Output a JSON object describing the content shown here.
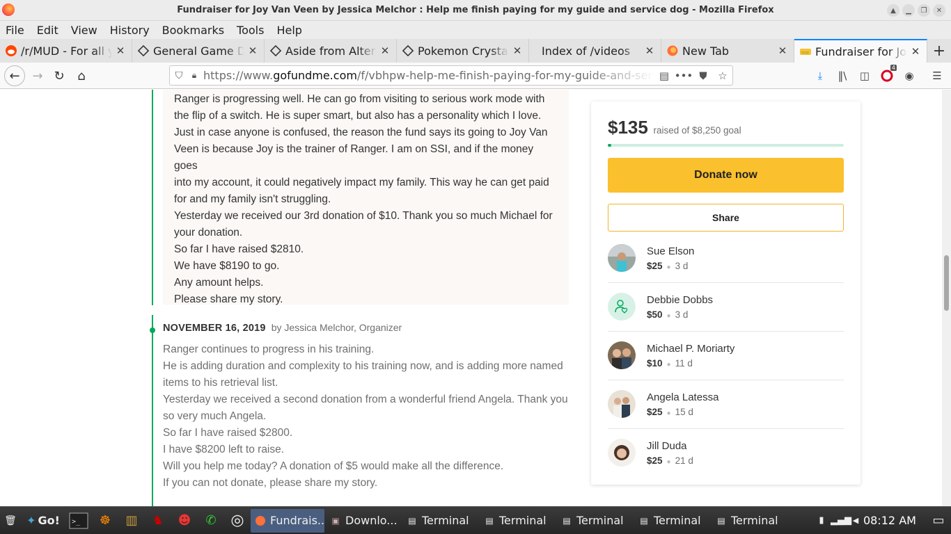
{
  "window": {
    "title": "Fundraiser for Joy Van Veen by Jessica Melchor : Help me finish paying for my guide and service dog - Mozilla Firefox"
  },
  "menu": [
    "File",
    "Edit",
    "View",
    "History",
    "Bookmarks",
    "Tools",
    "Help"
  ],
  "tabs": [
    {
      "label": "/r/MUD - For all your MUD needs",
      "icon": "reddit-icon"
    },
    {
      "label": "General Game Discussion",
      "icon": "diamond-icon"
    },
    {
      "label": "Aside from Alter aeon",
      "icon": "diamond-icon"
    },
    {
      "label": "Pokemon Crystal audio game",
      "icon": "diamond-icon"
    },
    {
      "label": "Index of /videos",
      "icon": ""
    },
    {
      "label": "New Tab",
      "icon": "firefox-icon"
    },
    {
      "label": "Fundraiser for Joy Van Veen",
      "icon": "gofundme-icon"
    }
  ],
  "urlbar": {
    "prefix": "https://www.",
    "domain": "gofundme.com",
    "path": "/f/vbhpw-help-me-finish-paying-for-my-guide-and-service-dog"
  },
  "toolbar": {
    "notification_count": "4"
  },
  "update1": {
    "lines": [
      "Ranger is progressing well. He can go from visiting to serious work mode with",
      "the flip of a switch. He is super smart, but also has a personality which I love.",
      "Just in case anyone is confused, the reason the fund says its going to Joy Van",
      "Veen is because Joy is the trainer of Ranger. I am on SSI, and if the money goes",
      "into my account, it could negatively impact my family. This way he can get paid",
      "for and my family isn't struggling.",
      "Yesterday we received our 3rd donation of $10. Thank you so much Michael for",
      "your donation.",
      "So far I have raised $2810.",
      "We have $8190 to go.",
      "Any amount helps.",
      "Please share my story."
    ]
  },
  "update2": {
    "date": "NOVEMBER 16, 2019",
    "author": "by Jessica Melchor, Organizer",
    "lines": [
      "Ranger continues to progress in his training.",
      "He is adding duration and complexity to his training now, and is adding more named",
      "items to his retrieval list.",
      "Yesterday we received a second donation from a wonderful friend Angela. Thank you",
      "so very much Angela.",
      "So far I have raised $2800.",
      "I have $8200 left to raise.",
      "Will you help me today? A donation of $5 would make all the difference.",
      "If you can not donate, please share my story."
    ]
  },
  "card": {
    "raised": "$135",
    "goal_text": "raised of $8,250 goal",
    "progress_fraction": 0.016,
    "donate_label": "Donate now",
    "share_label": "Share",
    "donors": [
      {
        "name": "Sue Elson",
        "amount": "$25",
        "time": "3 d",
        "avatar": "photo-avatar"
      },
      {
        "name": "Debbie Dobbs",
        "amount": "$50",
        "time": "3 d",
        "avatar": "person-heart-icon"
      },
      {
        "name": "Michael P. Moriarty",
        "amount": "$10",
        "time": "11 d",
        "avatar": "photo-avatar"
      },
      {
        "name": "Angela Latessa",
        "amount": "$25",
        "time": "15 d",
        "avatar": "photo-avatar"
      },
      {
        "name": "Jill Duda",
        "amount": "$25",
        "time": "21 d",
        "avatar": "photo-avatar"
      }
    ]
  },
  "taskbar": {
    "go_label": "Go!",
    "tasks": [
      {
        "label": "Fundrais...",
        "active": true
      },
      {
        "label": "Downlo...",
        "active": false
      },
      {
        "label": "Terminal",
        "active": false
      },
      {
        "label": "Terminal",
        "active": false
      },
      {
        "label": "Terminal",
        "active": false
      },
      {
        "label": "Terminal",
        "active": false
      },
      {
        "label": "Terminal",
        "active": false
      }
    ],
    "clock": "08:12 AM"
  },
  "colors": {
    "accent_green": "#02a95c",
    "donate_yellow": "#fbc02d",
    "tab_accent": "#0a84ff"
  }
}
